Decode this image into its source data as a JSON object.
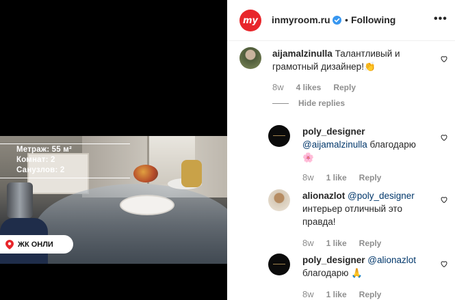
{
  "media": {
    "info_lines": [
      "Метраж: 55 м²",
      "Комнат: 2",
      "Санузлов: 2"
    ],
    "location": "ЖК ОНЛИ"
  },
  "header": {
    "avatar_text": "my",
    "account_name": "inmyroom.ru",
    "separator": "•",
    "follow_status": "Following",
    "more_label": "•••"
  },
  "comments": [
    {
      "username": "aijamalzinulla",
      "text_line1": "Талантливый и",
      "text_line2": "грамотный дизайнер!",
      "emoji": "👏",
      "time": "8w",
      "likes": "4 likes",
      "reply": "Reply",
      "hide_replies": "Hide replies"
    },
    {
      "username": "poly_designer",
      "mention": "@aijamalzinulla",
      "text": "благодарю",
      "emoji": "🌸",
      "time": "8w",
      "likes": "1 like",
      "reply": "Reply"
    },
    {
      "username": "alionazlot",
      "mention": "@poly_designer",
      "text_line1": "интерьер отличный это",
      "text_line2": "правда!",
      "time": "8w",
      "likes": "1 like",
      "reply": "Reply"
    },
    {
      "username": "poly_designer",
      "mention": "@alionazlot",
      "text": "благодарю",
      "emoji": "🙏",
      "time": "8w",
      "likes": "1 like",
      "reply": "Reply"
    }
  ],
  "colors": {
    "brand_red": "#e8262b",
    "verified_blue": "#3897f0",
    "mention_blue": "#00376b",
    "meta_gray": "#8e8e8e"
  }
}
